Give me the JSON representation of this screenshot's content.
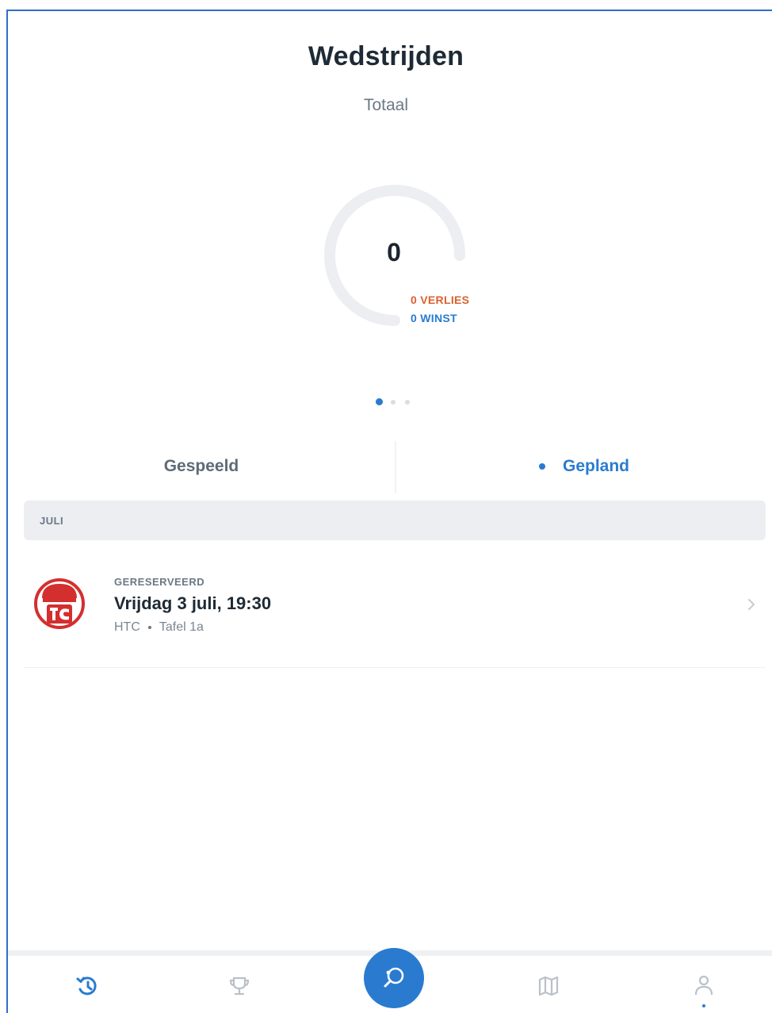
{
  "header": {
    "title": "Wedstrijden",
    "subtitle": "Totaal"
  },
  "summary": {
    "total": "0",
    "losses_label": "0 VERLIES",
    "wins_label": "0 WINST",
    "colors": {
      "loss": "#d9622f",
      "win": "#2a7bd0",
      "track": "#eceef1"
    },
    "pager": {
      "pages": 3,
      "active": 1
    }
  },
  "tabs": [
    {
      "label": "Gespeeld",
      "active": false
    },
    {
      "label": "Gepland",
      "active": true
    }
  ],
  "matches": {
    "month": "JULI",
    "items": [
      {
        "status": "GERESERVEERD",
        "title": "Vrijdag 3 juli, 19:30",
        "club": "HTC",
        "table": "Tafel 1a",
        "logo": "club-logo-tc",
        "logo_color": "#d32f2f"
      }
    ]
  },
  "bottom_nav": {
    "accent": "#2a7bd0",
    "items": [
      {
        "icon": "history-icon",
        "active": true
      },
      {
        "icon": "trophy-icon",
        "active": false
      },
      {
        "icon": "ping-pong-icon",
        "primary": true
      },
      {
        "icon": "map-icon",
        "active": false
      },
      {
        "icon": "profile-icon",
        "active": false,
        "notification": true
      }
    ]
  }
}
